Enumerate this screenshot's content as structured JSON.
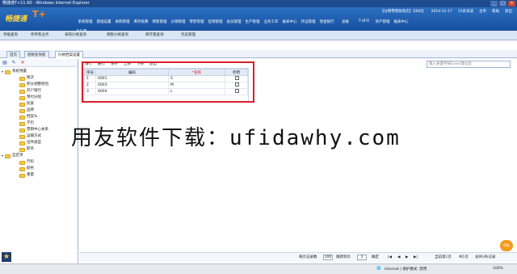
{
  "window": {
    "title": "畅捷通T+11.60 - Windows Internet Explorer",
    "controls": [
      "_",
      "□",
      "×"
    ]
  },
  "header": {
    "logo_text": "畅捷通",
    "logo_mark": "T+",
    "top_info": [
      "【分销零售联系店】【400】",
      "2014-12-17",
      "15条未读",
      "主单",
      "帮助",
      "退出"
    ],
    "main_nav": [
      "系统管理",
      "基础设置",
      "采购管理",
      "库存核算",
      "销售管理",
      "分销管理",
      "零售管理",
      "促销管理",
      "会员管理",
      "生产管理",
      "业务工作",
      "报表中心",
      "凭证管理",
      "现金银行",
      "总账",
      "T-UFO",
      "资产管理",
      "报表中心"
    ],
    "sub_row": "云应用"
  },
  "tabs_bar": {
    "items": [
      "单据查询",
      "停单和业务",
      "采购价格查询",
      "销售价格查询",
      "库存量查询",
      "凭证管理"
    ]
  },
  "page_tabs": {
    "items": [
      "首页",
      "初始化导航",
      "价格档案设置"
    ],
    "active_index": 2
  },
  "left_tools": {
    "icons": [
      "new-icon",
      "edit-icon",
      "delete-icon"
    ]
  },
  "tree": {
    "root1": "系统预置",
    "root1_children": [
      "税次",
      "积分调整原因",
      "开户银行",
      "预付分组",
      "民族",
      "品牌",
      "档案%",
      "学历",
      "营销中心关系",
      "运输方式",
      "证件类型",
      "职务"
    ],
    "root2": "自定项",
    "root2_children": [
      "尺码",
      "颜色",
      "重量"
    ]
  },
  "main": {
    "toolbar": [
      "增行",
      "删行",
      "保存",
      "上移",
      "下移",
      "退出"
    ],
    "search_placeholder": "输入关键字按Enter键过滤",
    "grid": {
      "headers": [
        "序号",
        "编码",
        "*名称",
        "停用"
      ],
      "rows": [
        {
          "no": "1",
          "code": "0001",
          "name": "S",
          "disabled": false
        },
        {
          "no": "2",
          "code": "0003",
          "name": "M",
          "disabled": false
        },
        {
          "no": "3",
          "code": "0004",
          "name": "L",
          "disabled": false
        }
      ]
    }
  },
  "watermark": "用友软件下载：ufidawhy.com",
  "pager": {
    "per_page_label": "每页记录数",
    "per_page_value": "100",
    "jump_label": "跳转到页",
    "jump_value": "1",
    "confirm_label": "确定",
    "nav_glyphs": [
      "|◀",
      "◀",
      "▶",
      "▶|"
    ],
    "current_page": "当前第1页",
    "total_pages": "共1页",
    "total_records": "总共3条记录"
  },
  "statusbar": {
    "zone": "Internet | 保护模式: 禁用",
    "zoom": "100%"
  },
  "help_label": "帮助"
}
